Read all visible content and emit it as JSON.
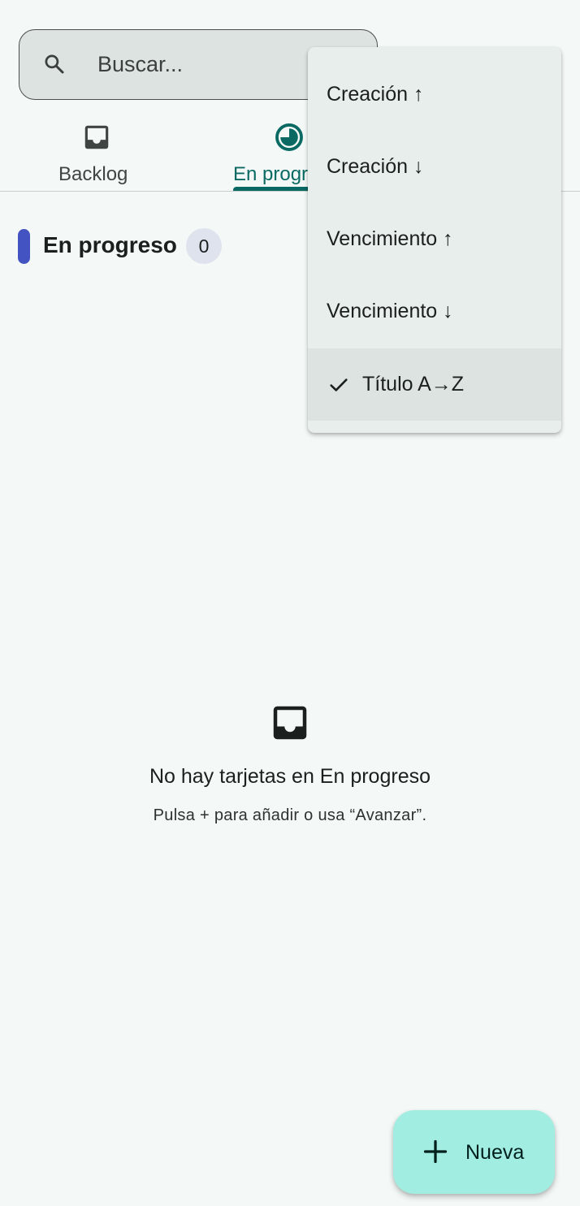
{
  "search": {
    "placeholder": "Buscar..."
  },
  "tabs": [
    {
      "label": "Backlog",
      "icon": "inbox-icon",
      "active": false
    },
    {
      "label": "En progr",
      "icon": "progress-clock-icon",
      "active": true
    }
  ],
  "section": {
    "title": "En progreso",
    "count": "0",
    "marker_color": "#4453c2"
  },
  "sort_menu": {
    "items": [
      {
        "label": "Creación ↑",
        "selected": false
      },
      {
        "label": "Creación ↓",
        "selected": false
      },
      {
        "label": "Vencimiento ↑",
        "selected": false
      },
      {
        "label": "Vencimiento ↓",
        "selected": false
      },
      {
        "label": "Título A→Z",
        "selected": true,
        "icon": "check-icon"
      }
    ]
  },
  "empty_state": {
    "icon": "inbox-icon",
    "title": "No hay tarjetas en En progreso",
    "hint": "Pulsa + para añadir o usa “Avanzar”."
  },
  "fab": {
    "label": "Nueva",
    "icon": "plus-icon",
    "color": "#a2ede2"
  },
  "colors": {
    "accent": "#0a6a63",
    "background": "#f4f9f7"
  }
}
